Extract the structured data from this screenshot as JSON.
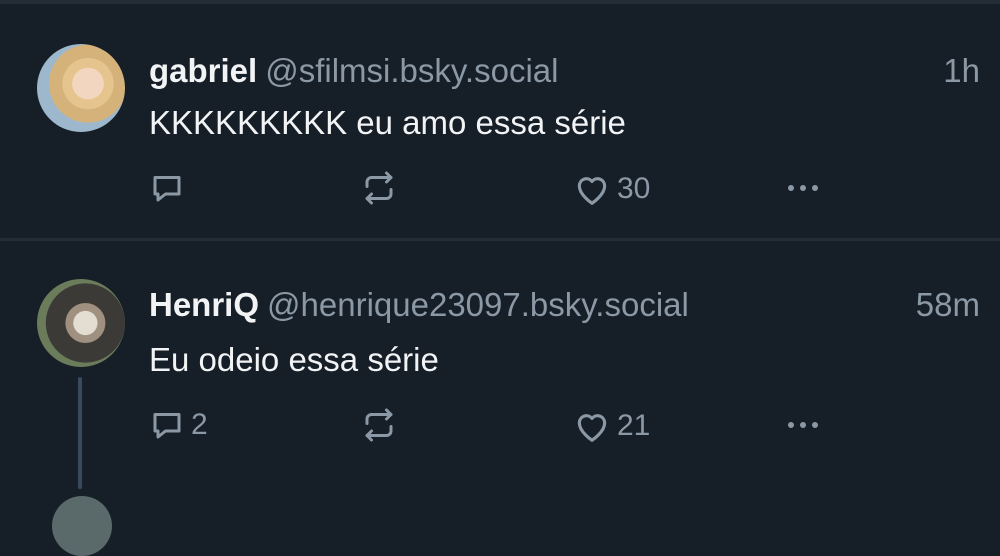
{
  "posts": [
    {
      "author_name": "gabriel",
      "author_handle": "@sfilmsi.bsky.social",
      "time": "1h",
      "text": "KKKKKKKKK eu amo essa série",
      "reply_count": "",
      "repost_count": "",
      "like_count": "30"
    },
    {
      "author_name": "HenriQ",
      "author_handle": "@henrique23097.bsky.social",
      "time": "58m",
      "text": "Eu odeio essa série",
      "reply_count": "2",
      "repost_count": "",
      "like_count": "21"
    }
  ],
  "colors": {
    "background": "#161e27",
    "text_primary": "#f1f3f5",
    "text_secondary": "#8b98a5",
    "thread_line": "#3a4a5e"
  },
  "icons": [
    "reply-icon",
    "repost-icon",
    "heart-icon",
    "more-icon"
  ]
}
